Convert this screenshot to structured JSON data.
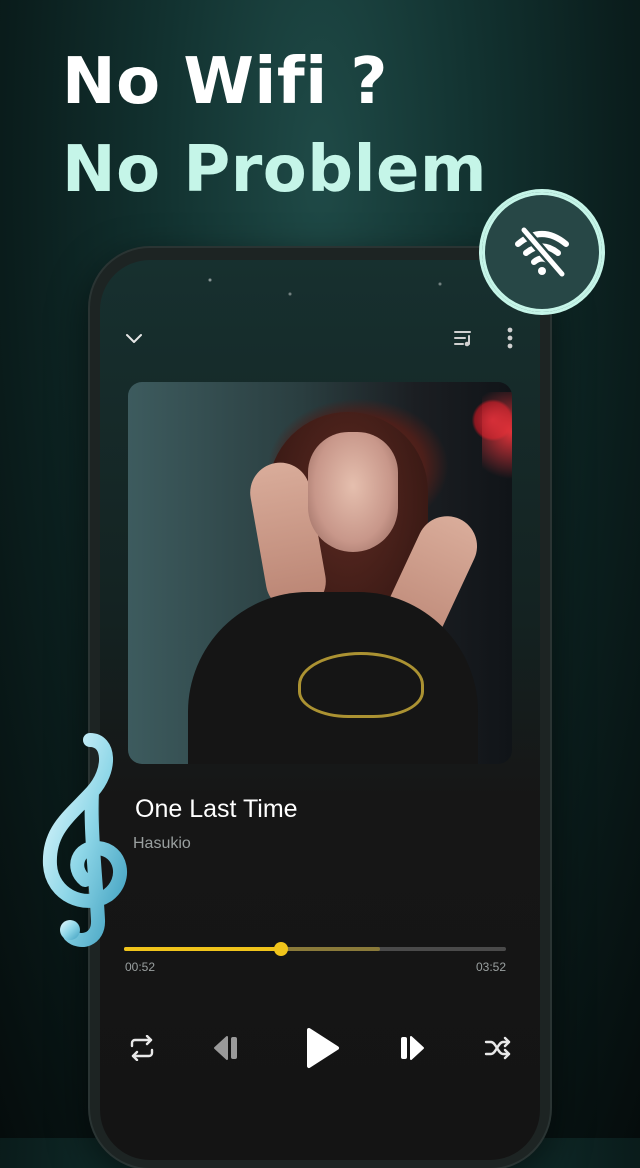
{
  "promo": {
    "line1": "No Wifi ?",
    "line2": "No Problem"
  },
  "badge": {
    "icon": "wifi-off-icon",
    "accent": "#c5f5e8"
  },
  "decoration": {
    "icon": "treble-clef-icon"
  },
  "header": {
    "collapse_icon": "chevron-down-icon",
    "queue_icon": "queue-music-icon",
    "more_icon": "more-vertical-icon"
  },
  "song": {
    "title": "One Last Time",
    "artist": "Hasukio"
  },
  "progress": {
    "elapsed": "00:52",
    "duration": "03:52",
    "played_fraction": 0.41,
    "buffered_fraction": 0.67,
    "color": "#f0c41b"
  },
  "controls": [
    {
      "name": "repeat-button",
      "icon": "repeat-icon"
    },
    {
      "name": "previous-button",
      "icon": "skip-previous-icon"
    },
    {
      "name": "play-button",
      "icon": "play-icon"
    },
    {
      "name": "next-button",
      "icon": "skip-next-icon"
    },
    {
      "name": "shuffle-button",
      "icon": "shuffle-icon"
    }
  ]
}
